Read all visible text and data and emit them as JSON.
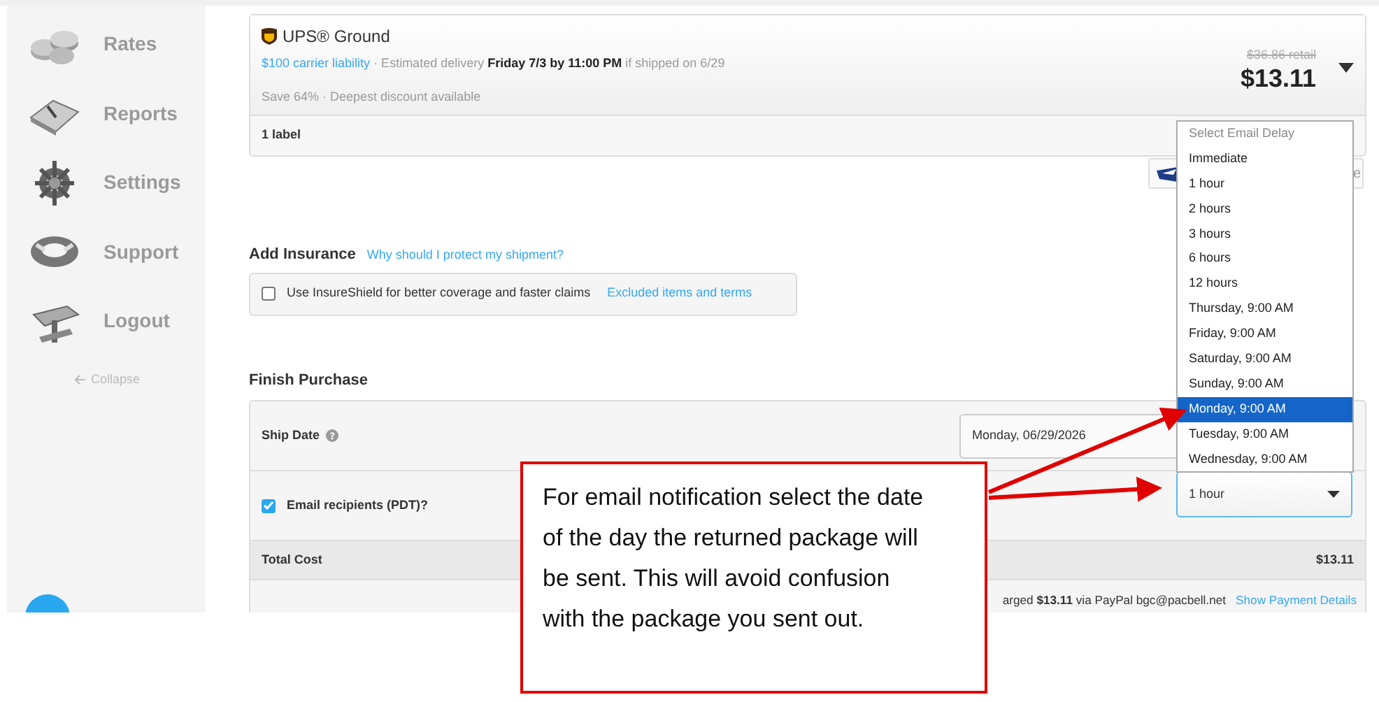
{
  "sidebar": {
    "items": [
      {
        "label": "Rates"
      },
      {
        "label": "Reports"
      },
      {
        "label": "Settings"
      },
      {
        "label": "Support"
      },
      {
        "label": "Logout"
      }
    ],
    "collapse": "Collapse"
  },
  "rate": {
    "carrier": "UPS® Ground",
    "liability": "$100 carrier liability",
    "delivery": "· Estimated delivery **Friday 7/3 by 11:00 PM** if shipped on 6/29",
    "savings": "Save 64% · Deepest discount available",
    "retail": "$36.86 retail",
    "price": "$13.11",
    "labels": "1 label"
  },
  "usps_badge": {
    "text": "e"
  },
  "insurance": {
    "title": "Add Insurance",
    "help_link": "Why should I protect my shipment?",
    "checkbox": {
      "label": "Use InsureShield for better coverage and faster claims",
      "checked": false
    },
    "terms_link": "Excluded items and terms"
  },
  "finish": {
    "title": "Finish Purchase",
    "ship_date": {
      "label": "Ship Date",
      "value": "Monday, 06/29/2026"
    },
    "email": {
      "label": "Email recipients (PDT)?",
      "checked": true,
      "value": "1 hour"
    },
    "total": {
      "label": "Total Cost",
      "value": "$13.11"
    },
    "payment": {
      "text": "arged **$13.11** via PayPal bgc@pacbell.net",
      "link": "Show Payment Details"
    }
  },
  "dropdown": {
    "options": [
      {
        "label": "Select Email Delay",
        "kind": "placeholder",
        "selected": false
      },
      {
        "label": "Immediate",
        "kind": "option",
        "selected": false
      },
      {
        "label": "1 hour",
        "kind": "option",
        "selected": false
      },
      {
        "label": "2 hours",
        "kind": "option",
        "selected": false
      },
      {
        "label": "3 hours",
        "kind": "option",
        "selected": false
      },
      {
        "label": "6 hours",
        "kind": "option",
        "selected": false
      },
      {
        "label": "12 hours",
        "kind": "option",
        "selected": false
      },
      {
        "label": "Thursday, 9:00 AM",
        "kind": "option",
        "selected": false
      },
      {
        "label": "Friday, 9:00 AM",
        "kind": "option",
        "selected": false
      },
      {
        "label": "Saturday, 9:00 AM",
        "kind": "option",
        "selected": false
      },
      {
        "label": "Sunday, 9:00 AM",
        "kind": "option",
        "selected": false
      },
      {
        "label": "Monday, 9:00 AM",
        "kind": "option",
        "selected": true
      },
      {
        "label": "Tuesday, 9:00 AM",
        "kind": "option",
        "selected": false
      },
      {
        "label": "Wednesday, 9:00 AM",
        "kind": "option",
        "selected": false
      }
    ]
  },
  "callout": {
    "text": "For email notification select the date of the day the returned package will be sent. This will avoid confusion with the package you sent out."
  }
}
